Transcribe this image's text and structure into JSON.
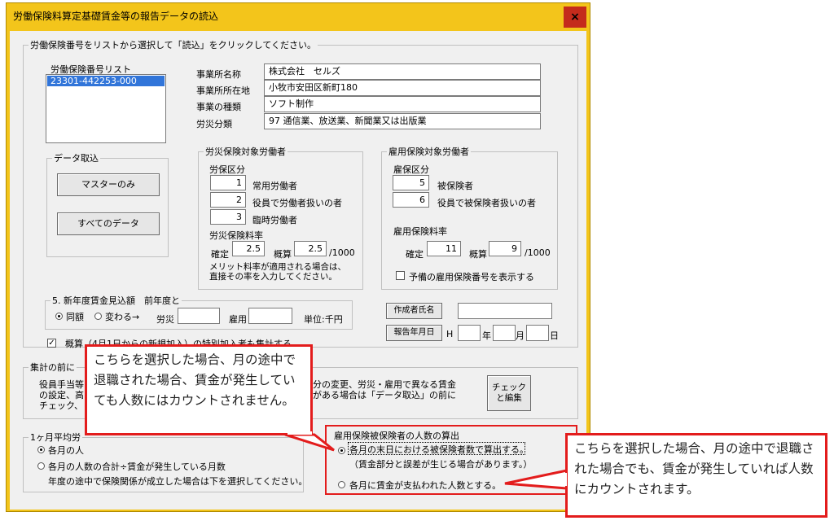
{
  "window": {
    "title": "労働保険料算定基礎賃金等の報告データの読込",
    "close": "×"
  },
  "instruction": "労働保険番号をリストから選択して「読込」をクリックしてください。",
  "list": {
    "label": "労働保険番号リスト",
    "items": [
      "23301-442253-000"
    ]
  },
  "office": {
    "name_label": "事業所名称",
    "name_value": "株式会社　セルズ",
    "address_label": "事業所所在地",
    "address_value": "小牧市安田区新町180",
    "type_label": "事業の種類",
    "type_value": "ソフト制作",
    "class_label": "労災分類",
    "class_value": "97 通信業、放送業、新聞業又は出版業"
  },
  "import": {
    "legend": "データ取込",
    "master_only": "マスターのみ",
    "all_data": "すべてのデータ"
  },
  "rousai": {
    "legend": "労災保険対象労働者",
    "class_label": "労保区分",
    "rows": [
      {
        "num": "1",
        "label": "常用労働者"
      },
      {
        "num": "2",
        "label": "役員で労働者扱いの者"
      },
      {
        "num": "3",
        "label": "臨時労働者"
      }
    ],
    "rate_label": "労災保険料率",
    "fixed_label": "確定",
    "fixed_value": "2.5",
    "approx_label": "概算",
    "approx_value": "2.5",
    "unit": "/1000",
    "note": "メリット料率が適用される場合は、直接その率を入力してください。"
  },
  "koyou": {
    "legend": "雇用保険対象労働者",
    "class_label": "雇保区分",
    "rows": [
      {
        "num": "5",
        "label": "被保険者"
      },
      {
        "num": "6",
        "label": "役員で被保険者扱いの者"
      }
    ],
    "rate_label": "雇用保険料率",
    "fixed_label": "確定",
    "fixed_value": "11",
    "approx_label": "概算",
    "approx_value": "9",
    "unit": "/1000",
    "reserve_check": "予備の雇用保険番号を表示する"
  },
  "estimate": {
    "legend": "5. 新年度賃金見込額　前年度と",
    "same": "同額",
    "changed": "変わる→",
    "rousai": "労災",
    "koyou": "雇用",
    "unit": "単位:千円"
  },
  "creator": {
    "button": "作成者氏名",
    "date_button": "報告年月日",
    "era": "H",
    "year": "年",
    "month": "月",
    "day": "日"
  },
  "approx_check": "概算（4月1日からの新規加入）の特別加入者も集計する",
  "aggregate": {
    "legend": "集計の前に",
    "line1a": "役員手当等",
    "line1b": "分の変更、労災・雇用で異なる賃金",
    "line2a": "の設定、高",
    "line2b": "がある場合は「データ取込」の前に",
    "line3a": "チェック、また",
    "check_button": "チェックと編集"
  },
  "monthly": {
    "legend": "1ヶ月平均労",
    "opt1": "各月の人",
    "opt2": "各月の人数の合計÷賃金が発生している月数",
    "note": "年度の途中で保険関係が成立した場合は下を選択してください。"
  },
  "insured": {
    "legend": "雇用保険被保険者の人数の算出",
    "opt1": "各月の末日における被保険者数で算出する。",
    "opt1_note": "（賃金部分と誤差が生じる場合があります。）",
    "opt2": "各月に賃金が支払われた人数とする。"
  },
  "callouts": {
    "left": "こちらを選択した場合、月の途中で退職された場合、賃金が発生していても人数にはカウントされません。",
    "right": "こちらを選択した場合、月の途中で退職された場合でも、賃金が発生していれば人数にカウントされます。"
  }
}
